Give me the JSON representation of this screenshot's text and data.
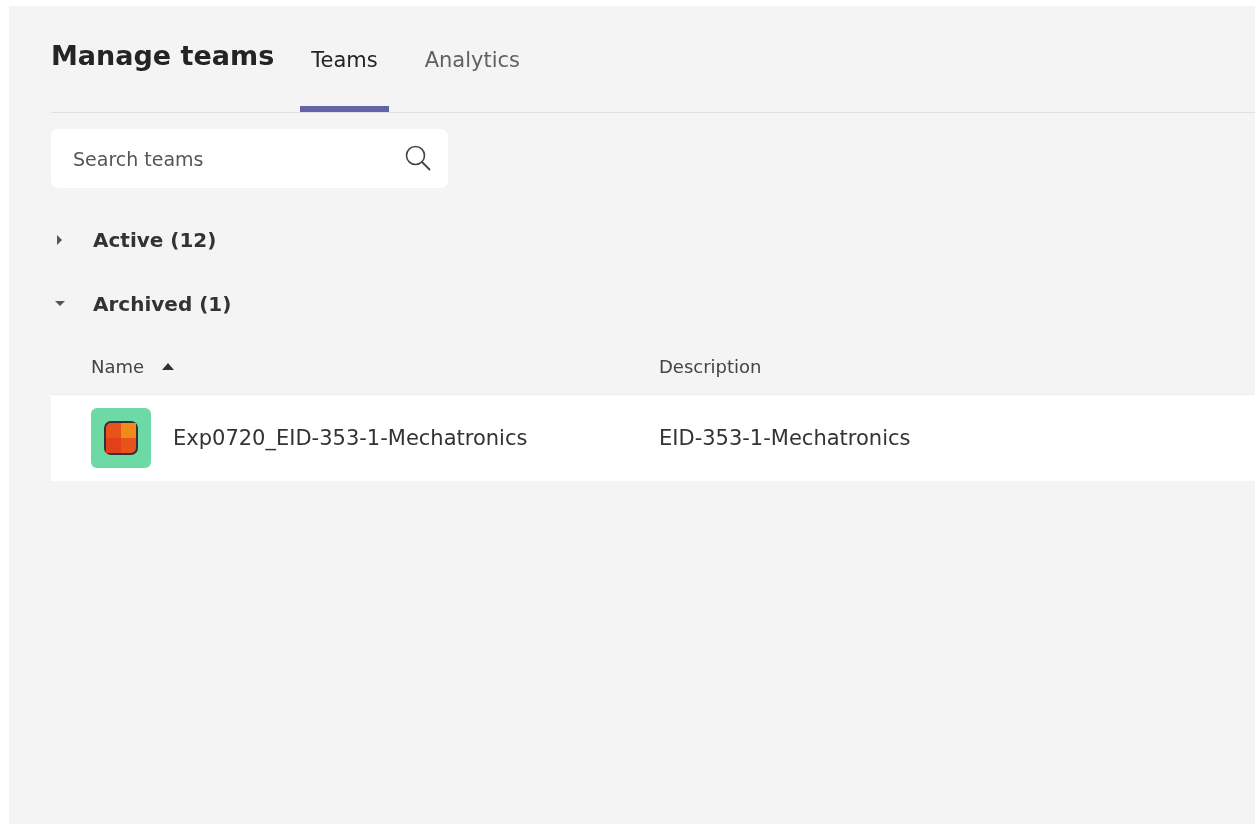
{
  "title": "Manage teams",
  "tabs": [
    {
      "label": "Teams",
      "selected": true
    },
    {
      "label": "Analytics",
      "selected": false
    }
  ],
  "search": {
    "placeholder": "Search teams"
  },
  "groups": [
    {
      "label": "Active (12)",
      "expanded": false
    },
    {
      "label": "Archived (1)",
      "expanded": true,
      "columns": [
        {
          "label": "Name",
          "sorted": true
        },
        {
          "label": "Description",
          "sorted": false
        }
      ],
      "rows": [
        {
          "name": "Exp0720_EID-353-1-Mechatronics",
          "description": "EID-353-1-Mechatronics"
        }
      ]
    }
  ]
}
